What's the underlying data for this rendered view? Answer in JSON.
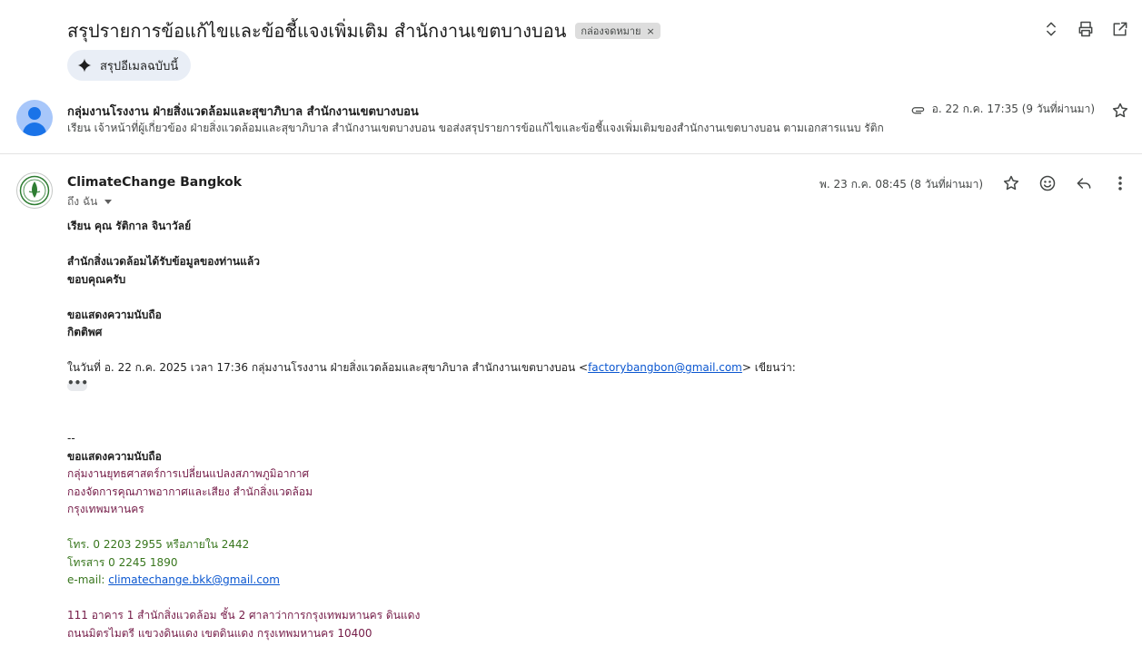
{
  "thread": {
    "subject": "สรุปรายการข้อแก้ไขและข้อชี้แจงเพิ่มเติม สำนักงานเขตบางบอน",
    "label": "กล่องจดหมาย",
    "label_remove": "×",
    "summarize_label": "สรุปอีเมลฉบับนี้"
  },
  "top_actions": [
    "expand-collapse-icon",
    "print-icon",
    "open-new-window-icon"
  ],
  "message_collapsed": {
    "sender": "กลุ่มงานโรงงาน ฝ่ายสิ่งแวดล้อมและสุขาภิบาล สำนักงานเขตบางบอน",
    "snippet": "เรียน เจ้าหน้าที่ผู้เกี่ยวข้อง ฝ่ายสิ่งแวดล้อมและสุขาภิบาล สำนักงานเขตบางบอน ขอส่งสรุปรายการข้อแก้ไขและข้อชี้แจงเพิ่มเติมของสำนักงานเขตบางบอน ตามเอกสารแนบ รัติก",
    "date": "อ. 22 ก.ค. 17:35 (9 วันที่ผ่านมา)",
    "icons": [
      "attachment-icon",
      "star-icon"
    ]
  },
  "message_open": {
    "sender": "ClimateChange Bangkok",
    "to": "ถึง ฉัน",
    "date": "พ. 23 ก.ค. 08:45 (8 วันที่ผ่านมา)",
    "icons": [
      "star-icon",
      "emoji-icon",
      "reply-icon",
      "more-vert-icon"
    ],
    "body": {
      "greeting": "เรียน คุณ รัติกาล จินาวัลย์",
      "line1": "สำนักสิ่งแวดล้อมได้รับข้อมูลของท่านแล้ว",
      "line2": "ขอบคุณครับ",
      "closing1": "ขอแสดงความนับถือ",
      "closing2": "กิตติพศ",
      "quote_prefix": "ในวันที่ อ. 22 ก.ค. 2025 เวลา 17:36 กลุ่มงานโรงงาน ฝ่ายสิ่งแวดล้อมและสุขาภิบาล สำนักงานเขตบางบอน <",
      "quote_email": "factorybangbon@gmail.com",
      "quote_suffix": "> เขียนว่า:",
      "dots": "•••"
    },
    "signature": {
      "separator": "--",
      "regards": "ขอแสดงความนับถือ",
      "org1": "กลุ่มงานยุทธศาสตร์การเปลี่ยนแปลงสภาพภูมิอากาศ",
      "org2": "กองจัดการคุณภาพอากาศและเสียง สำนักสิ่งแวดล้อม",
      "org3": "กรุงเทพมหานคร",
      "phone": "โทร. 0 2203 2955 หรือภายใน 2442",
      "fax": "โทรสาร 0 2245 1890",
      "email_label": "e-mail: ",
      "email": "climatechange.bkk@gmail.com",
      "address1": "111 อาคาร 1 สำนักสิ่งแวดล้อม ชั้น 2 ศาลาว่าการกรุงเทพมหานคร ดินแดง",
      "address2": "ถนนมิตรไมตรี แขวงดินแดง เขตดินแดง กรุงเทพมหานคร 10400"
    }
  },
  "colors": {
    "signature_maroon": "#741b47",
    "signature_green": "#38761d",
    "link": "#0b57d0",
    "summarize_bg": "#e9eef6"
  }
}
